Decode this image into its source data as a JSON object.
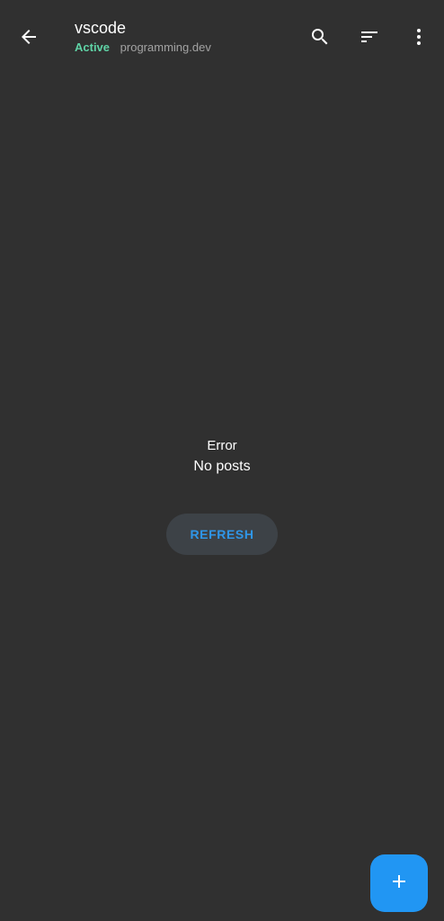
{
  "header": {
    "title": "vscode",
    "status": "Active",
    "instance": "programming.dev",
    "icons": {
      "back": "arrow-back-icon",
      "search": "search-icon",
      "sort": "sort-icon",
      "more": "more-vert-icon"
    }
  },
  "empty_state": {
    "title": "Error",
    "message": "No posts",
    "refresh_label": "REFRESH"
  },
  "fab": {
    "icon": "plus-icon"
  },
  "colors": {
    "background": "#303030",
    "status_active": "#5fd3a6",
    "accent": "#2196f3",
    "refresh_text": "#2f96e8",
    "refresh_bg": "#3d4247"
  }
}
